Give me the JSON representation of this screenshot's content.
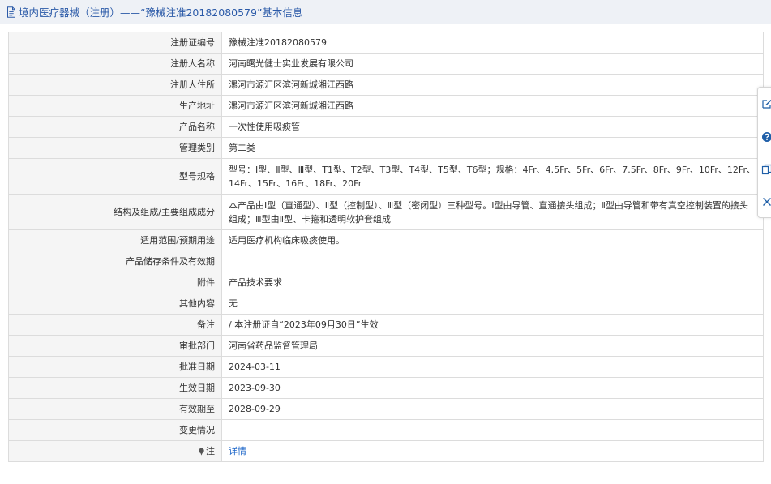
{
  "header": {
    "title": "境内医疗器械（注册）——“豫械注准20182080579”基本信息"
  },
  "rows": [
    {
      "label": "注册证编号",
      "value": "豫械注准20182080579"
    },
    {
      "label": "注册人名称",
      "value": "河南曙光健士实业发展有限公司"
    },
    {
      "label": "注册人住所",
      "value": "漯河市源汇区滨河新城湘江西路"
    },
    {
      "label": "生产地址",
      "value": "漯河市源汇区滨河新城湘江西路"
    },
    {
      "label": "产品名称",
      "value": "一次性使用吸痰管"
    },
    {
      "label": "管理类别",
      "value": "第二类"
    },
    {
      "label": "型号规格",
      "value": "型号：Ⅰ型、Ⅱ型、Ⅲ型、T1型、T2型、T3型、T4型、T5型、T6型；规格：4Fr、4.5Fr、5Fr、6Fr、7.5Fr、8Fr、9Fr、10Fr、12Fr、14Fr、15Fr、16Fr、18Fr、20Fr"
    },
    {
      "label": "结构及组成/主要组成成分",
      "value": "本产品由Ⅰ型（直通型）、Ⅱ型（控制型）、Ⅲ型（密闭型）三种型号。Ⅰ型由导管、直通接头组成；Ⅱ型由导管和带有真空控制装置的接头组成；Ⅲ型由Ⅱ型、卡箍和透明软护套组成"
    },
    {
      "label": "适用范围/预期用途",
      "value": "适用医疗机构临床吸痰使用。"
    },
    {
      "label": "产品储存条件及有效期",
      "value": ""
    },
    {
      "label": "附件",
      "value": "产品技术要求"
    },
    {
      "label": "其他内容",
      "value": "无"
    },
    {
      "label": "备注",
      "value": "/ 本注册证自“2023年09月30日”生效"
    },
    {
      "label": "审批部门",
      "value": "河南省药品监督管理局"
    },
    {
      "label": "批准日期",
      "value": "2024-03-11"
    },
    {
      "label": "生效日期",
      "value": "2023-09-30"
    },
    {
      "label": "有效期至",
      "value": "2028-09-29"
    },
    {
      "label": "变更情况",
      "value": ""
    },
    {
      "label": "注",
      "value": "详情"
    }
  ],
  "icons": {
    "header": "document-icon",
    "note": "pin-icon",
    "side": [
      "edit-icon",
      "help-icon",
      "copy-icon",
      "close-icon"
    ]
  }
}
